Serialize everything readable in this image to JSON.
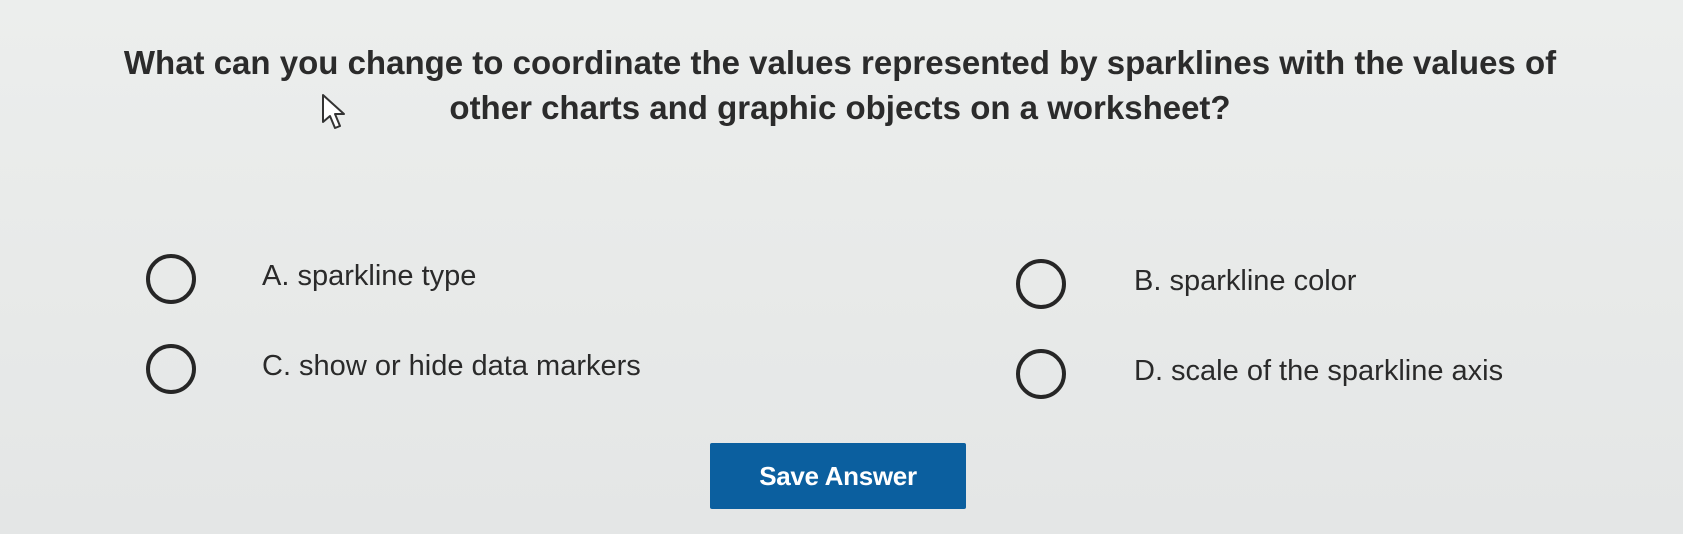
{
  "question": {
    "line1": "What can you change to coordinate the values represented by sparklines with the values of",
    "line2": "other charts and graphic objects on a worksheet?"
  },
  "options": [
    {
      "id": "A",
      "label": "A. sparkline type",
      "selected": false
    },
    {
      "id": "B",
      "label": "B. sparkline color",
      "selected": false
    },
    {
      "id": "C",
      "label": "C. show or hide data markers",
      "selected": false
    },
    {
      "id": "D",
      "label": "D. scale of the sparkline axis",
      "selected": false
    }
  ],
  "save_button": {
    "label": "Save Answer",
    "color": "#0b5f9f"
  },
  "icons": {
    "cursor": "mouse-pointer-icon"
  }
}
